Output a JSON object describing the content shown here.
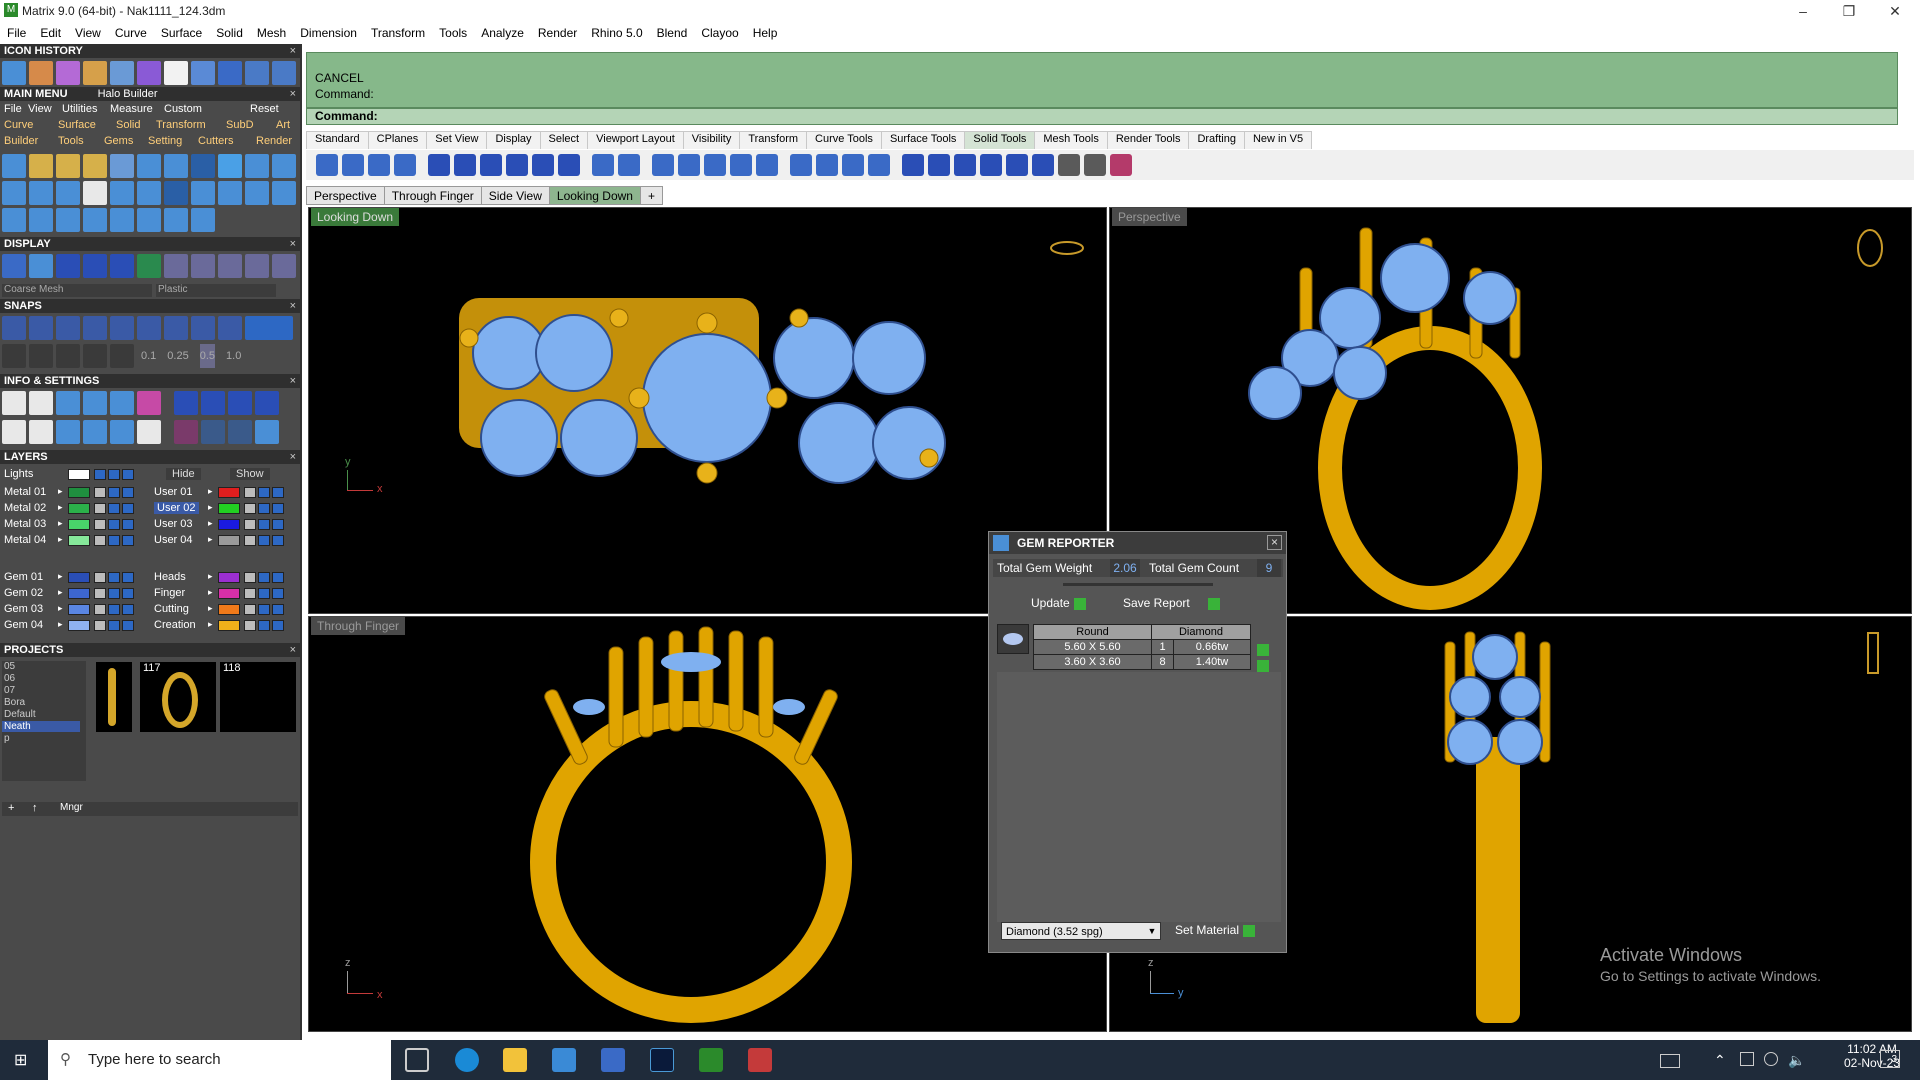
{
  "window": {
    "title": "Matrix 9.0 (64-bit) - Nak1111_124.3dm",
    "app_icon": "matrix-icon"
  },
  "menubar": [
    "File",
    "Edit",
    "View",
    "Curve",
    "Surface",
    "Solid",
    "Mesh",
    "Dimension",
    "Transform",
    "Tools",
    "Analyze",
    "Render",
    "Rhino 5.0",
    "Blend",
    "Clayoo",
    "Help"
  ],
  "left": {
    "icon_history": "ICON HISTORY",
    "main_menu": "MAIN MENU",
    "main_menu_sub": "Halo Builder",
    "main_menu_row1": [
      "File",
      "View",
      "Utilities",
      "Measure",
      "Custom",
      "Reset"
    ],
    "main_menu_row2": [
      "Curve",
      "Surface",
      "Solid",
      "Transform",
      "SubD",
      "Art"
    ],
    "main_menu_row3": [
      "Builder",
      "Tools",
      "Gems",
      "Setting",
      "Cutters",
      "Render"
    ],
    "display": "DISPLAY",
    "display_mesh": "Coarse Mesh",
    "display_material": "Plastic",
    "snaps": "SNAPS",
    "snap_values": [
      "0.1",
      "0.25",
      "0.5",
      "1.0"
    ],
    "info": "INFO & SETTINGS",
    "layers": "LAYERS",
    "lights": "Lights",
    "hide": "Hide",
    "show": "Show",
    "layer_left": [
      {
        "name": "Metal 01",
        "color": "#1f8f3f"
      },
      {
        "name": "Metal 02",
        "color": "#2bb04a"
      },
      {
        "name": "Metal 03",
        "color": "#49d46a"
      },
      {
        "name": "Metal 04",
        "color": "#86e89a"
      },
      {
        "name": "Gem 01",
        "color": "#2a4eb6"
      },
      {
        "name": "Gem 02",
        "color": "#3d66cf"
      },
      {
        "name": "Gem 03",
        "color": "#5a86e3"
      },
      {
        "name": "Gem 04",
        "color": "#8fb2f1"
      }
    ],
    "layer_right": [
      {
        "name": "User 01",
        "color": "#e01e1e"
      },
      {
        "name": "User 02",
        "color": "#22d022"
      },
      {
        "name": "User 03",
        "color": "#1a1ae0"
      },
      {
        "name": "User 04",
        "color": "#9a9a9a"
      },
      {
        "name": "Heads",
        "color": "#9b2fd1"
      },
      {
        "name": "Finger",
        "color": "#d82fa8"
      },
      {
        "name": "Cutting",
        "color": "#f07a1a"
      },
      {
        "name": "Creation",
        "color": "#f0b01a"
      }
    ],
    "projects": "PROJECTS",
    "project_list": [
      "05",
      "06",
      "07",
      "Bora",
      "Default",
      "Neath",
      "p"
    ],
    "project_selected": "Neath",
    "thumb_labels": [
      "117",
      "118"
    ],
    "mngr": "Mngr"
  },
  "cmd": {
    "line1": "CANCEL",
    "line2": "Command:",
    "prompt": "Command:"
  },
  "toolbar_tabs": [
    "Standard",
    "CPlanes",
    "Set View",
    "Display",
    "Select",
    "Viewport Layout",
    "Visibility",
    "Transform",
    "Curve Tools",
    "Surface Tools",
    "Solid Tools",
    "Mesh Tools",
    "Render Tools",
    "Drafting",
    "New in V5"
  ],
  "toolbar_active": "Solid Tools",
  "viewport_tabs": [
    "Perspective",
    "Through Finger",
    "Side View",
    "Looking Down"
  ],
  "viewport_tab_active": "Looking Down",
  "viewports": {
    "tl": {
      "label": "Looking Down",
      "axis_v": "y",
      "axis_h": "x"
    },
    "tr": {
      "label": "Perspective"
    },
    "bl": {
      "label": "Through Finger",
      "axis_v": "z",
      "axis_h": "x"
    },
    "br": {
      "axis_v": "z",
      "axis_h": "y"
    }
  },
  "gem_reporter": {
    "title": "GEM REPORTER",
    "total_weight_label": "Total Gem Weight",
    "total_weight": "2.06",
    "total_count_label": "Total Gem Count",
    "total_count": "9",
    "update": "Update",
    "save_report": "Save Report",
    "table_headers": [
      "Round",
      "Diamond"
    ],
    "rows": [
      {
        "size": "5.60 X 5.60",
        "count": "1",
        "weight": "0.66tw"
      },
      {
        "size": "3.60 X 3.60",
        "count": "8",
        "weight": "1.40tw"
      }
    ],
    "material": "Diamond   (3.52 spg)",
    "set_material": "Set Material"
  },
  "watermark": {
    "line1": "Activate Windows",
    "line2": "Go to Settings to activate Windows."
  },
  "taskbar": {
    "search_placeholder": "Type here to search",
    "time": "11:02 AM",
    "date": "02-Nov-23",
    "notification_count": "3"
  },
  "colors": {
    "gold": "#e0a400",
    "gem": "#7fb0f0",
    "cmd_bg": "#86b88a"
  }
}
